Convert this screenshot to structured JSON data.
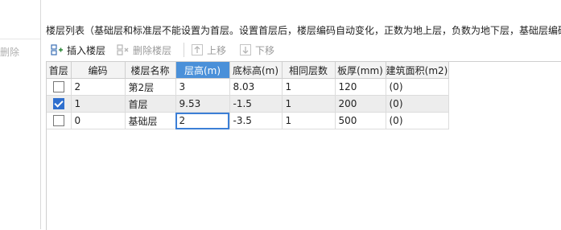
{
  "hint": "楼层列表（基础层和标准层不能设置为首层。设置首层后，楼层编码自动变化，正数为地上层，负数为地下层，基础层编码",
  "left_panel": {
    "delete_label": "删除"
  },
  "toolbar": {
    "insert_label": "插入楼层",
    "delete_label": "删除楼层",
    "up_label": "上移",
    "down_label": "下移"
  },
  "table": {
    "columns": [
      "首层",
      "编码",
      "楼层名称",
      "层高(m)",
      "底标高(m)",
      "相同层数",
      "板厚(mm)",
      "建筑面积(m2)"
    ],
    "active_column": "层高(m)",
    "rows": [
      {
        "first_floor": false,
        "code": "2",
        "name": "第2层",
        "height": "3",
        "bottom_elev": "8.03",
        "same_count": "1",
        "slab": "120",
        "area": "(0)"
      },
      {
        "first_floor": true,
        "code": "1",
        "name": "首层",
        "height": "9.53",
        "bottom_elev": "-1.5",
        "same_count": "1",
        "slab": "200",
        "area": "(0)"
      },
      {
        "first_floor": false,
        "code": "0",
        "name": "基础层",
        "height": "2",
        "bottom_elev": "-3.5",
        "same_count": "1",
        "slab": "500",
        "area": "(0)"
      }
    ]
  },
  "colors": {
    "accent": "#4a90d9",
    "checkbox": "#2f6fce",
    "edit_border": "#3c7fd6"
  }
}
